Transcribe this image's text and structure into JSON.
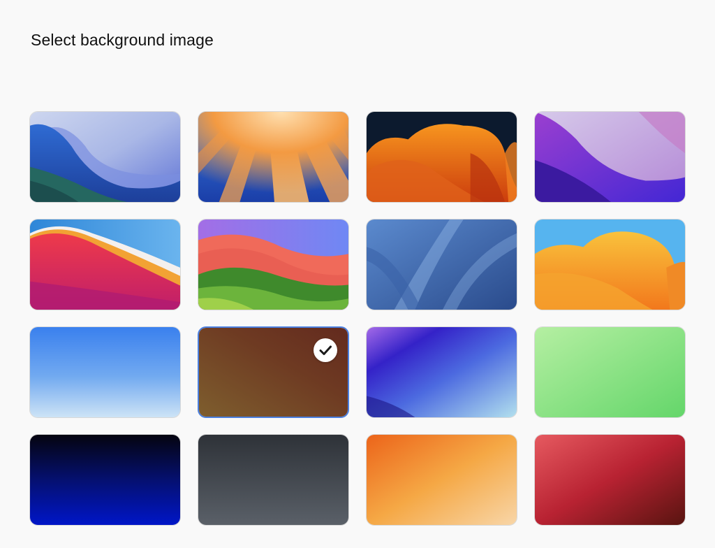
{
  "page": {
    "title": "Select background image"
  },
  "backgrounds": [
    {
      "name": "monterey-blue",
      "selected": false,
      "colors": [
        "#2c5fc4",
        "#9fb4e4",
        "#2f6a6a"
      ]
    },
    {
      "name": "ventura-sunrise",
      "selected": false,
      "colors": [
        "#1e4fb8",
        "#f5a050",
        "#5aa0e0"
      ]
    },
    {
      "name": "ventura-orange",
      "selected": false,
      "colors": [
        "#0c1a2e",
        "#f07a1a",
        "#c2370f"
      ]
    },
    {
      "name": "monterey-purple",
      "selected": false,
      "colors": [
        "#b24fcf",
        "#c7a6e0",
        "#4b2bd0"
      ]
    },
    {
      "name": "big-sur",
      "selected": false,
      "colors": [
        "#e8305a",
        "#f2a234",
        "#3b8ad8"
      ]
    },
    {
      "name": "sonoma",
      "selected": false,
      "colors": [
        "#7b8ef0",
        "#e8504a",
        "#3c8a2e"
      ]
    },
    {
      "name": "blue-waves",
      "selected": false,
      "colors": [
        "#3a6ab6",
        "#6e9ad2",
        "#2b4e8e"
      ]
    },
    {
      "name": "ventura-yellow",
      "selected": false,
      "colors": [
        "#56b4ef",
        "#f6b230",
        "#f07c1e"
      ]
    },
    {
      "name": "sky-blue-gradient",
      "selected": false,
      "colors": [
        "#3f86ee",
        "#bcdcf6"
      ]
    },
    {
      "name": "brown-gradient",
      "selected": true,
      "colors": [
        "#7a5a2c",
        "#6a2c1e"
      ]
    },
    {
      "name": "violet-gradient",
      "selected": false,
      "colors": [
        "#3a22c8",
        "#a5d6ee"
      ]
    },
    {
      "name": "green-gradient",
      "selected": false,
      "colors": [
        "#b3ee9e",
        "#6ad86e"
      ]
    },
    {
      "name": "navy-gradient",
      "selected": false,
      "colors": [
        "#050515",
        "#0018c8"
      ]
    },
    {
      "name": "slate-gradient",
      "selected": false,
      "colors": [
        "#2f3338",
        "#565c64"
      ]
    },
    {
      "name": "orange-gradient",
      "selected": false,
      "colors": [
        "#ee6a1a",
        "#f8d2a0"
      ]
    },
    {
      "name": "crimson-gradient",
      "selected": false,
      "colors": [
        "#e2545a",
        "#5a1410"
      ]
    }
  ],
  "selected_indicator": {
    "icon": "checkmark-icon",
    "background": "#ffffff",
    "glyph_color": "#1a1a1a"
  },
  "accent": "#4a7fe0"
}
